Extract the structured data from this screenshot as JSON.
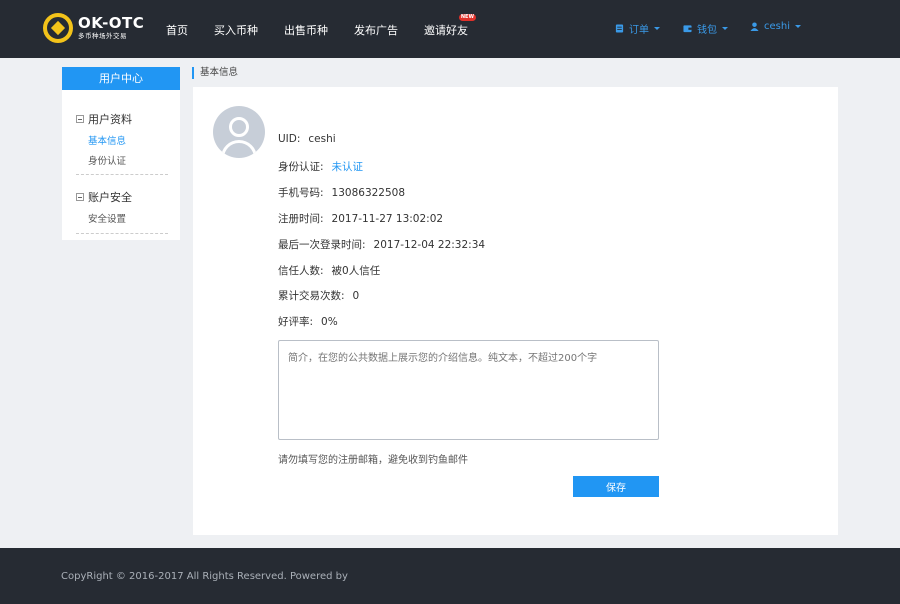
{
  "header": {
    "logo_title": "OK-OTC",
    "logo_subtitle": "多币种场外交易",
    "brand_color": "#f3c31a",
    "nav": [
      {
        "label": "首页"
      },
      {
        "label": "买入币种"
      },
      {
        "label": "出售币种"
      },
      {
        "label": "发布广告"
      },
      {
        "label": "邀请好友",
        "badge": "NEW"
      }
    ],
    "user_menus": [
      {
        "label": "订单",
        "icon": "order-icon"
      },
      {
        "label": "钱包",
        "icon": "wallet-icon"
      },
      {
        "label": "ceshi",
        "icon": "user-icon"
      }
    ]
  },
  "sidebar": {
    "title": "用户中心",
    "groups": [
      {
        "title": "用户资料",
        "items": [
          {
            "label": "基本信息",
            "active": true
          },
          {
            "label": "身份认证",
            "active": false
          }
        ]
      },
      {
        "title": "账户安全",
        "items": [
          {
            "label": "安全设置",
            "active": false
          }
        ]
      }
    ]
  },
  "breadcrumb": "基本信息",
  "profile": {
    "fields": [
      {
        "label": "UID:",
        "value": "ceshi"
      },
      {
        "label": "身份认证:",
        "value": "未认证",
        "link": true
      },
      {
        "label": "手机号码:",
        "value": "13086322508"
      },
      {
        "label": "注册时间:",
        "value": "2017-11-27 13:02:02"
      },
      {
        "label": "最后一次登录时间:",
        "value": "2017-12-04 22:32:34"
      },
      {
        "label": "信任人数:",
        "value": "被0人信任"
      },
      {
        "label": "累计交易次数:",
        "value": "0"
      },
      {
        "label": "好评率:",
        "value": "0%"
      }
    ],
    "intro_placeholder": "简介，在您的公共数据上展示您的介绍信息。纯文本，不超过200个字",
    "hint": "请勿填写您的注册邮箱，避免收到钓鱼邮件",
    "save_label": "保存"
  },
  "footer": {
    "copyright": "CopyRight © 2016-2017 All Rights Reserved. Powered by"
  },
  "colors": {
    "accent": "#2196f3",
    "header_bg": "#262b33",
    "page_bg": "#eef0f3"
  }
}
